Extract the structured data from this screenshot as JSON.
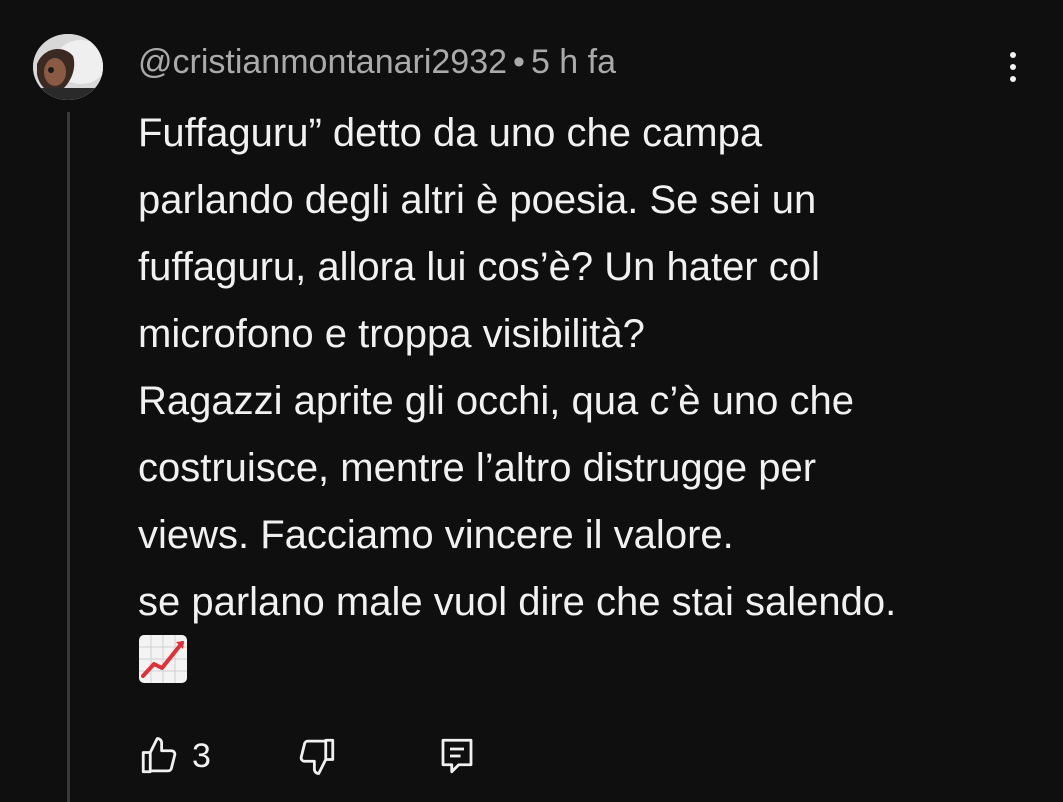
{
  "comment": {
    "author": "@cristianmontanari2932",
    "separator": "•",
    "time": "5 h fa",
    "lines": [
      "Fuffaguru” detto da uno che campa",
      "parlando degli altri è poesia. Se sei un",
      "fuffaguru, allora lui cos’è? Un hater col",
      "microfono e troppa visibilità?",
      "Ragazzi aprite gli occhi, qua c’è uno che",
      "costruisce, mentre l’altro distrugge per",
      "views. Facciamo vincere il valore.",
      "se parlano male vuol dire che stai salendo."
    ],
    "emoji": "chart-increasing-emoji"
  },
  "actions": {
    "like_count": "3",
    "like_icon": "thumbs-up-icon",
    "dislike_icon": "thumbs-down-icon",
    "reply_icon": "reply-icon"
  },
  "colors": {
    "background": "#0f0f0f",
    "text": "#f1f1f1",
    "secondary_text": "#aaaaaa",
    "thread_line": "#3a3a3a"
  }
}
